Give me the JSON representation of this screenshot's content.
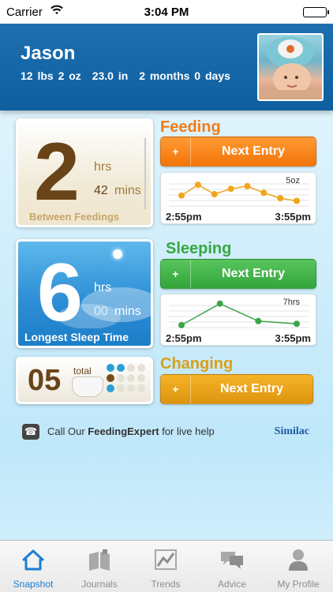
{
  "status_bar": {
    "carrier": "Carrier",
    "time": "3:04 PM"
  },
  "profile": {
    "name": "Jason",
    "weight": "12 lbs 2 oz",
    "length": "23.0 in",
    "age": "2 months 0 days"
  },
  "feeding": {
    "title": "Feeding",
    "big_value": "2",
    "hrs_label": "hrs",
    "mins_value": "42",
    "mins_label": "mins",
    "caption": "Between Feedings",
    "button_plus": "+",
    "button_label": "Next Entry",
    "chart": {
      "peak_label": "5oz",
      "start_time": "2:55pm",
      "end_time": "3:55pm",
      "color": "#f0a51b",
      "points": [
        0.45,
        0.85,
        0.5,
        0.7,
        0.8,
        0.55,
        0.35,
        0.25
      ]
    }
  },
  "sleeping": {
    "title": "Sleeping",
    "big_value": "6",
    "hrs_label": "hrs",
    "mins_value": "00",
    "mins_label": "mins",
    "caption": "Longest Sleep Time",
    "button_plus": "+",
    "button_label": "Next Entry",
    "chart": {
      "peak_label": "7hrs",
      "start_time": "2:55pm",
      "end_time": "3:55pm",
      "color": "#3aa547",
      "points": [
        0.15,
        0.95,
        0.3,
        0.2
      ]
    }
  },
  "changing": {
    "title": "Changing",
    "count": "05",
    "total_label": "total",
    "button_plus": "+",
    "button_label": "Next Entry",
    "dot_colors": [
      "#2a9fd6",
      "#2a9fd6",
      "#e6e1d6",
      "#e6e1d6",
      "#7a4a1c",
      "#e6e1d6",
      "#e6e1d6",
      "#e6e1d6",
      "#2a9fd6",
      "#e6e1d6",
      "#e6e1d6",
      "#e6e1d6"
    ]
  },
  "help": {
    "prefix": "Call Our ",
    "emphasis": "FeedingExpert",
    "suffix": " for live help",
    "brand": "Similac"
  },
  "tabs": [
    {
      "label": "Snapshot",
      "icon": "home-icon",
      "active": true
    },
    {
      "label": "Journals",
      "icon": "journal-icon",
      "active": false
    },
    {
      "label": "Trends",
      "icon": "trends-icon",
      "active": false
    },
    {
      "label": "Advice",
      "icon": "advice-icon",
      "active": false
    },
    {
      "label": "My Profile",
      "icon": "profile-icon",
      "active": false
    }
  ],
  "colors": {
    "accent": "#1c7ed6",
    "feeding": "#ef7d1a",
    "sleeping": "#38a743",
    "changing": "#d8a11a"
  }
}
